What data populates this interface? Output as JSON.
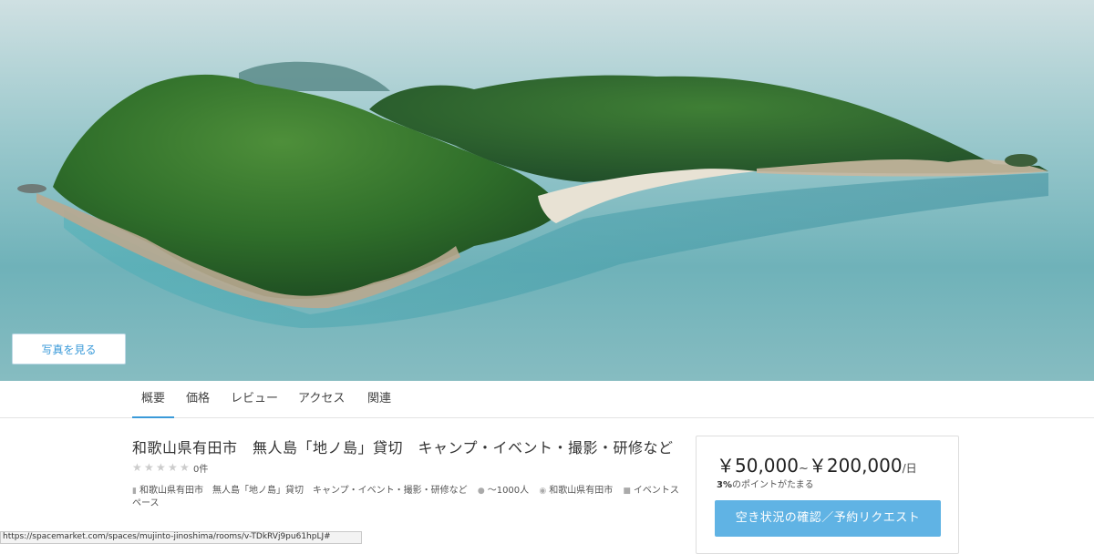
{
  "hero": {
    "photo_button_label": "写真を見る"
  },
  "tabs": [
    {
      "label": "概要",
      "active": true
    },
    {
      "label": "価格",
      "active": false
    },
    {
      "label": "レビュー",
      "active": false
    },
    {
      "label": "アクセス",
      "active": false
    },
    {
      "label": "関連",
      "active": false
    }
  ],
  "listing": {
    "title": "和歌山県有田市　無人島「地ノ島」貸切　キャンプ・イベント・撮影・研修など",
    "rating_stars": 0,
    "review_count": "0件",
    "meta": {
      "name": "和歌山県有田市　無人島「地ノ島」貸切　キャンプ・イベント・撮影・研修など",
      "capacity": "〜1000人",
      "location": "和歌山県有田市",
      "category": "イベントスペース"
    }
  },
  "price_card": {
    "price_min": "￥50,000",
    "separator": "~",
    "price_max": "￥200,000",
    "unit": "/日",
    "points_rate": "3%",
    "points_text": "のポイントがたまる",
    "reserve_button_label": "空き状況の確認／予約リクエスト"
  },
  "status_bar": {
    "url": "https://spacemarket.com/spaces/mujinto-jinoshima/rooms/v-TDkRVj9pu61hpLJ#"
  },
  "colors": {
    "accent": "#3a9ad9",
    "button": "#60b3e4"
  }
}
